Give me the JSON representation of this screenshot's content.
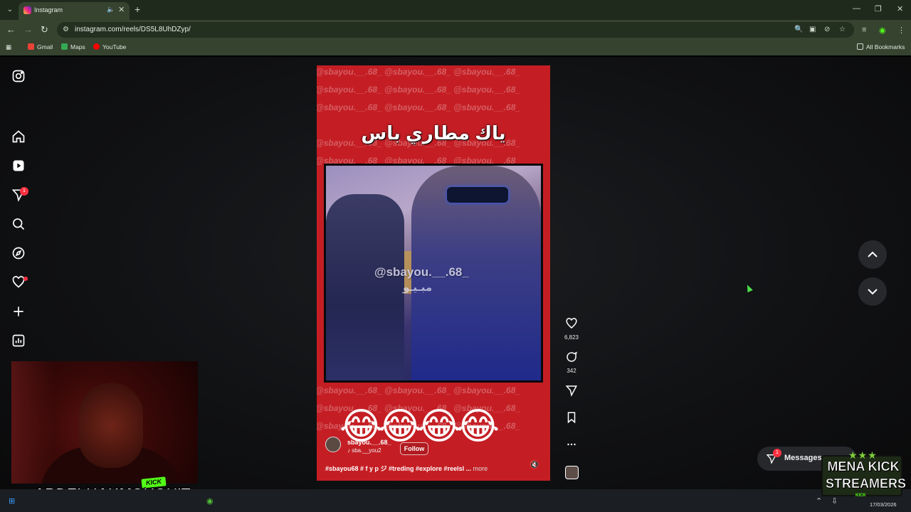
{
  "browser": {
    "tab_title": "Instagram",
    "url": "instagram.com/reels/DS5L8UhDZyp/",
    "bookmarks": [
      "Gmail",
      "Maps",
      "YouTube"
    ],
    "all_bookmarks": "All Bookmarks"
  },
  "sidebar": {
    "notifications_badge": "1"
  },
  "reel": {
    "watermark": "@sbayou.__.68_",
    "caption_arabic": "ياك مطاري باس",
    "video_watermark": "@sbayou.__.68_",
    "video_watermark_arabic": "مبـيـو",
    "emojis": "😂😂😂😂",
    "username": "sbayou.__.68_",
    "audio": "sba.__you2",
    "follow_label": "Follow",
    "caption": "#sbayou68 # f y p ジ #treding #explore #reelsl ...",
    "more_label": "more"
  },
  "actions": {
    "likes": "6,823",
    "comments": "342"
  },
  "messages": {
    "label": "Messages",
    "badge": "1"
  },
  "overlay": {
    "streamer_name": "ABDELHAKMOUGHIT",
    "kick_tag": "KICK",
    "mena_line1": "MENA KICK",
    "mena_line2": "STREAMERS",
    "mena_stars": "★★★",
    "mena_kick": "KICK"
  },
  "taskbar": {
    "date": "17/03/2026"
  },
  "colors": {
    "reel_red": "#c41e24",
    "notification_red": "#ff3040",
    "kick_green": "#53fc18"
  }
}
